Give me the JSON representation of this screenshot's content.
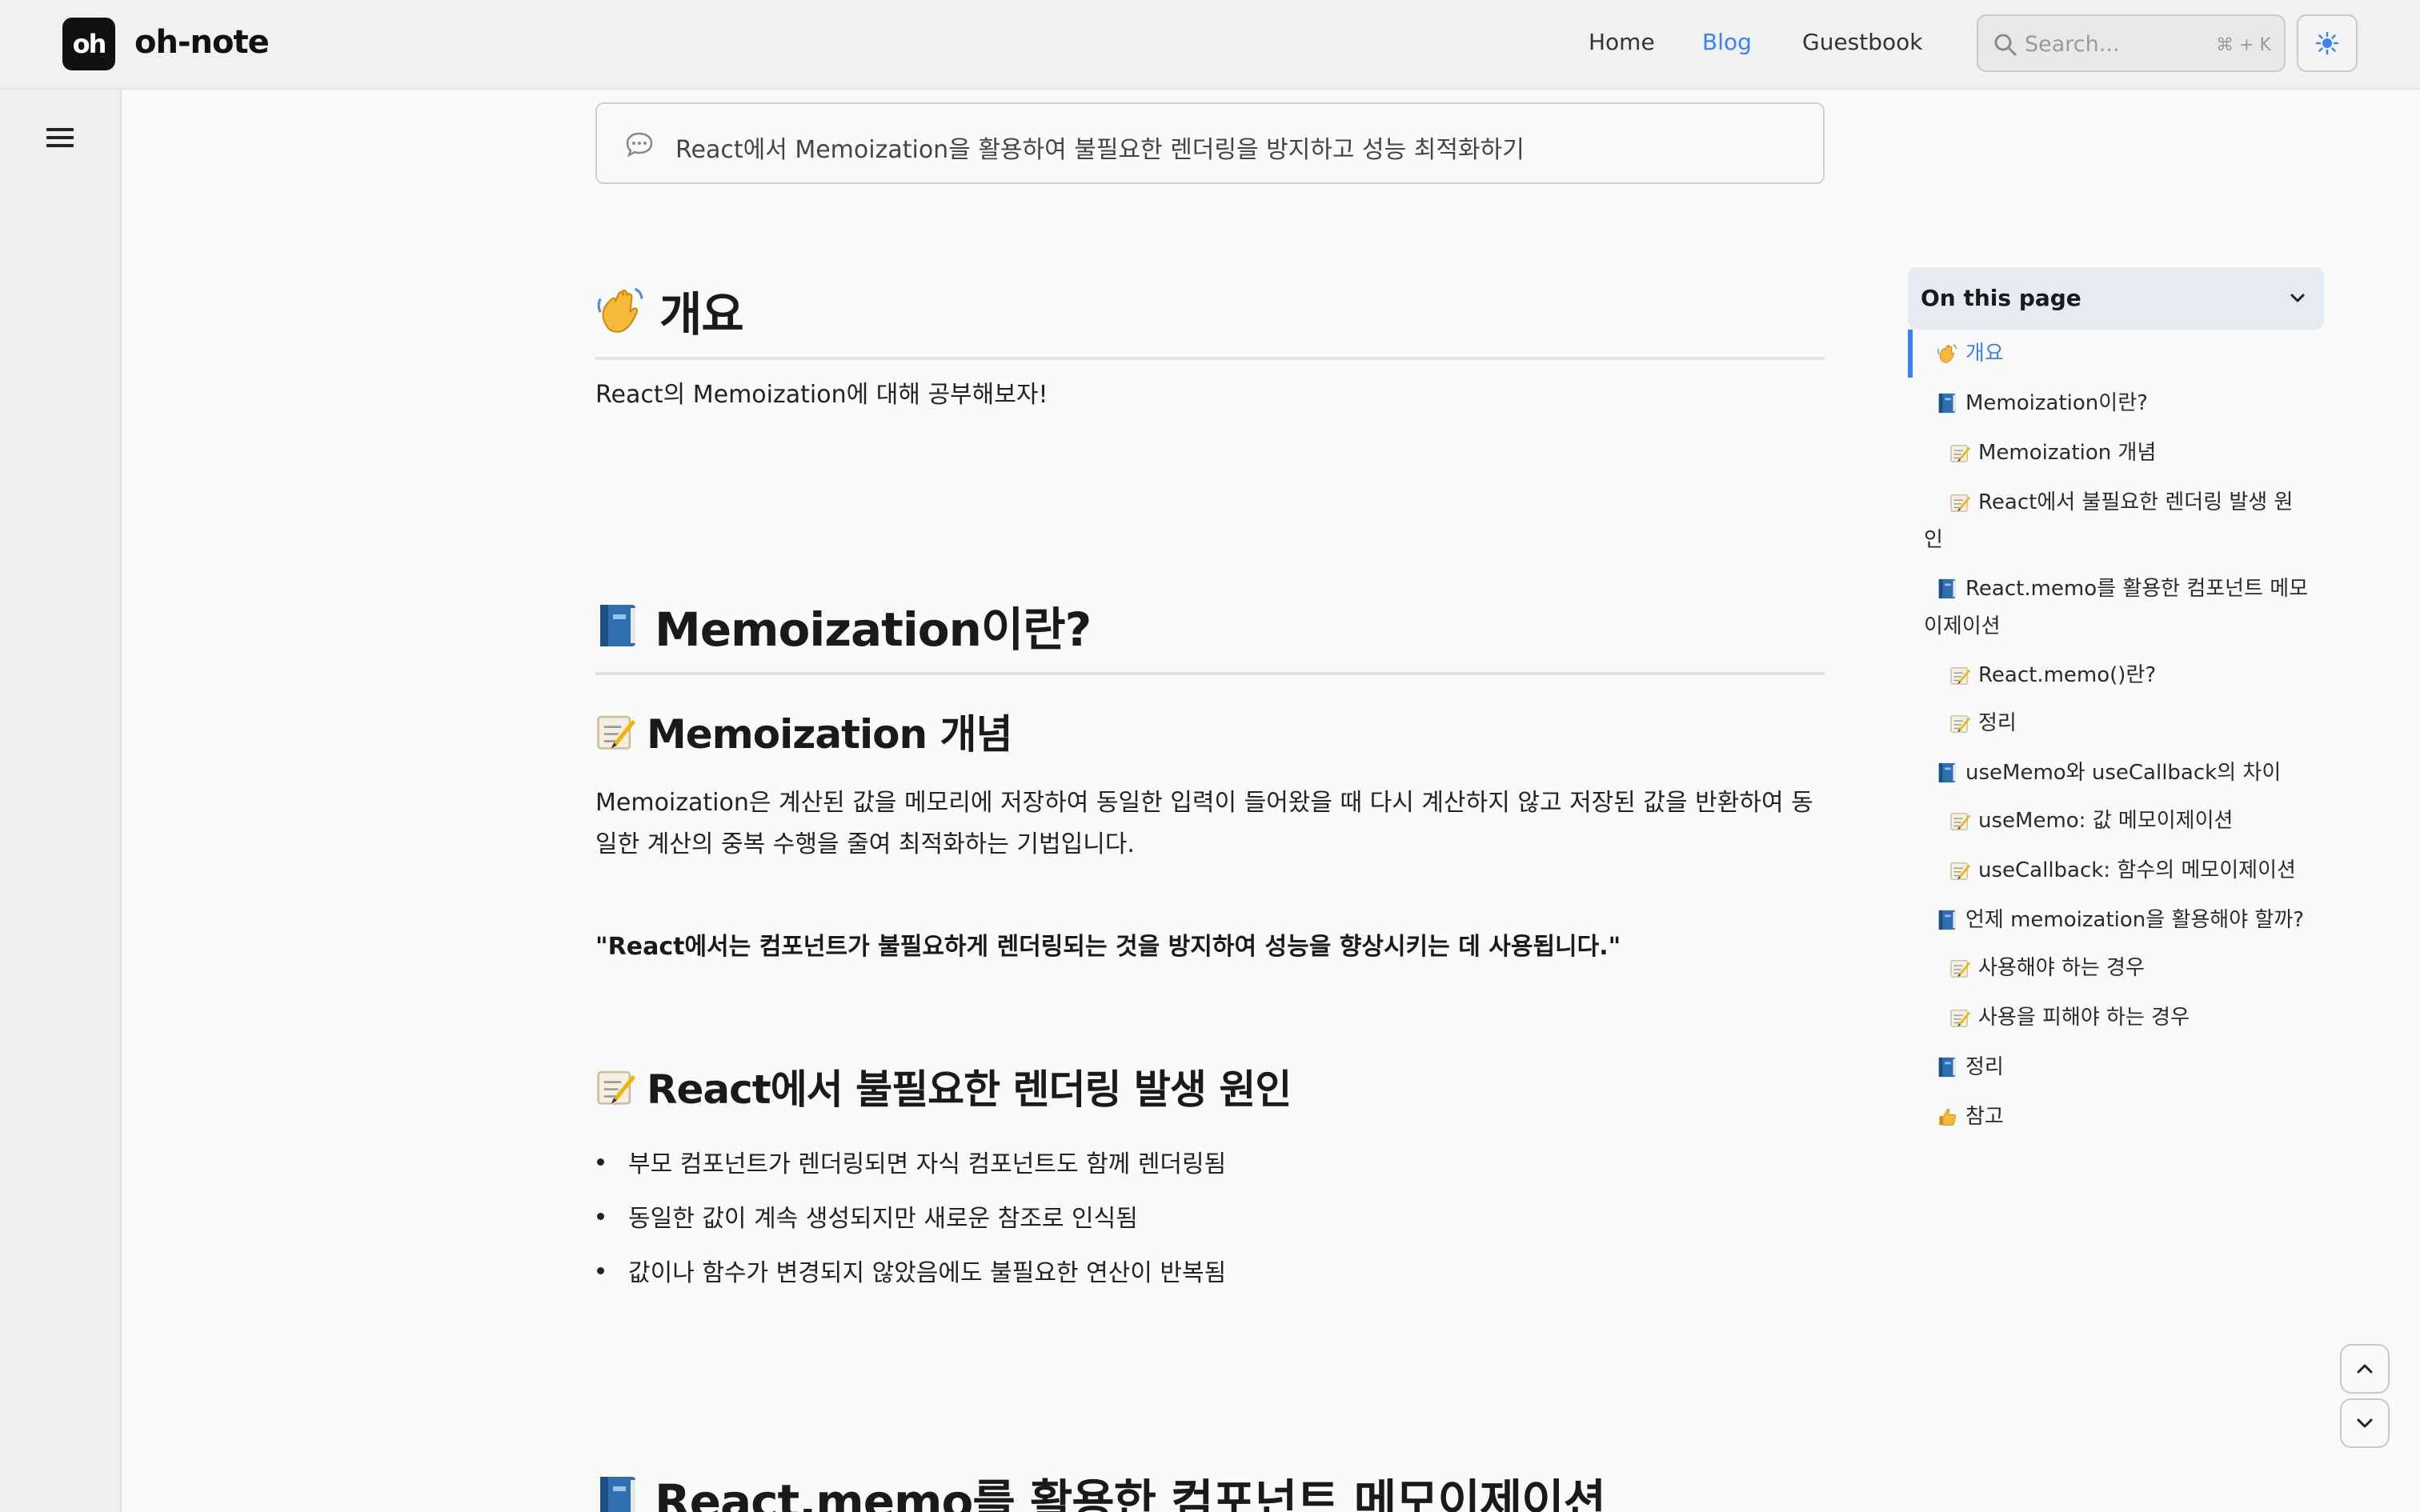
{
  "header": {
    "logo_text": "oh",
    "site_name": "oh-note",
    "nav": {
      "home": "Home",
      "blog": "Blog",
      "guestbook": "Guestbook"
    },
    "search": {
      "placeholder": "Search...",
      "shortcut": "⌘ + K"
    },
    "accent_color": "#3b82f6"
  },
  "summary": {
    "text": "React에서 Memoization을 활용하여 불필요한 렌더링을 방지하고 성능 최적화하기"
  },
  "article": {
    "s1_title": "개요",
    "s1_para": "React의 Memoization에 대해 공부해보자!",
    "s2_title": "Memoization이란?",
    "s2_sub1": "Memoization 개념",
    "s2_sub1_para": "Memoization은 계산된 값을 메모리에 저장하여 동일한 입력이 들어왔을 때 다시 계산하지 않고 저장된 값을 반환하여 동일한 계산의 중복 수행을 줄여 최적화하는 기법입니다.",
    "s2_quote": "\"React에서는 컴포넌트가 불필요하게 렌더링되는 것을 방지하여 성능을 향상시키는 데 사용됩니다.\"",
    "s2_sub2": "React에서 불필요한 렌더링 발생 원인",
    "s2_bullets": [
      "부모 컴포넌트가 렌더링되면 자식 컴포넌트도 함께 렌더링됨",
      "동일한 값이 계속 생성되지만 새로운 참조로 인식됨",
      "값이나 함수가 변경되지 않았음에도 불필요한 연산이 반복됨"
    ],
    "s3_title": "React.memo를 활용한 컴포넌트 메모이제이션"
  },
  "toc": {
    "title": "On this page",
    "items": [
      {
        "label": "개요",
        "icon": "wave-icon"
      },
      {
        "label": "Memoization이란?",
        "icon": "book-icon"
      },
      {
        "label": "Memoization 개념",
        "icon": "memo-icon"
      },
      {
        "label": "React에서 불필요한 렌더링 발생 원",
        "label2": "인",
        "icon": "memo-icon"
      },
      {
        "label": "React.memo를 활용한 컴포넌트 메모",
        "label2": "이제이션",
        "icon": "book-icon"
      },
      {
        "label": "React.memo()란?",
        "icon": "memo-icon"
      },
      {
        "label": "정리",
        "icon": "memo-icon"
      },
      {
        "label": "useMemo와 useCallback의 차이",
        "icon": "book-icon"
      },
      {
        "label": "useMemo: 값 메모이제이션",
        "icon": "memo-icon"
      },
      {
        "label": "useCallback: 함수의 메모이제이션",
        "icon": "memo-icon"
      },
      {
        "label": "언제 memoization을 활용해야 할까?",
        "icon": "book-icon"
      },
      {
        "label": "사용해야 하는 경우",
        "icon": "memo-icon"
      },
      {
        "label": "사용을 피해야 하는 경우",
        "icon": "memo-icon"
      },
      {
        "label": "정리",
        "icon": "book-icon"
      },
      {
        "label": "참고",
        "icon": "thumbs-up-icon"
      }
    ]
  }
}
